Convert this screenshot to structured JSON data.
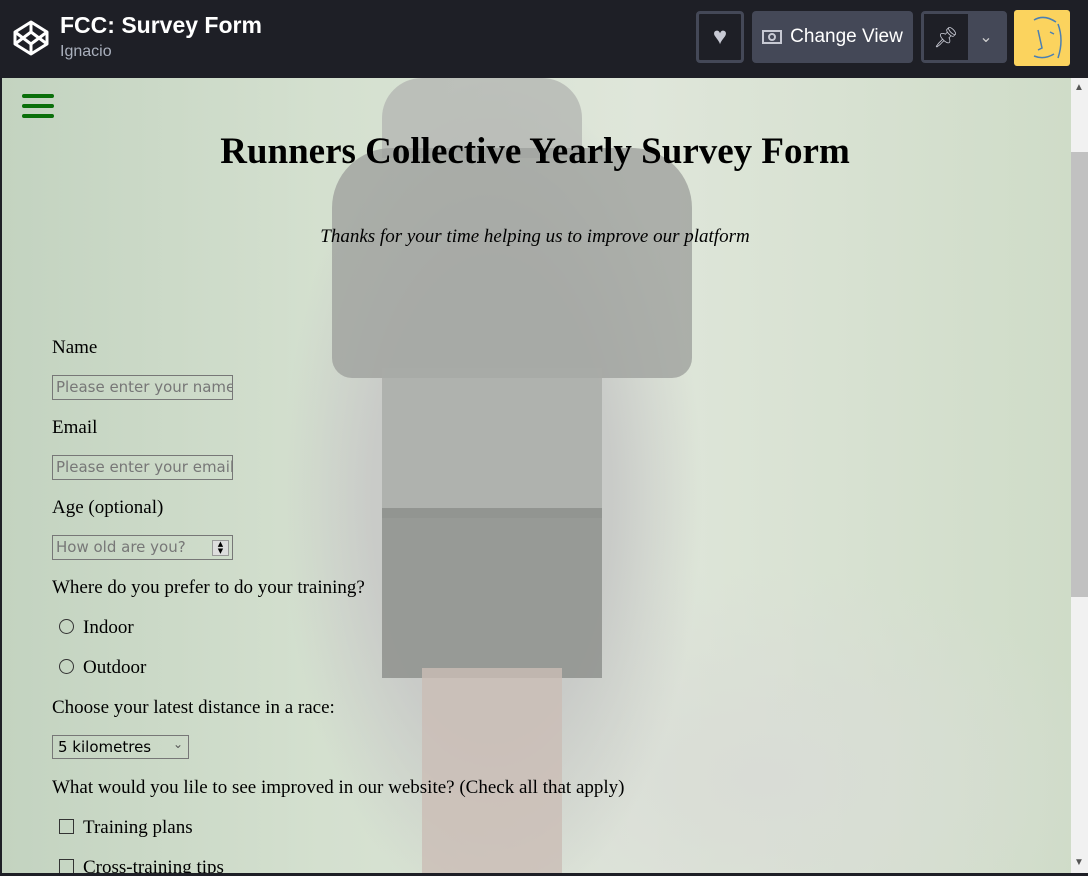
{
  "header": {
    "title": "FCC: Survey Form",
    "author": "Ignacio",
    "change_view": "Change View"
  },
  "form": {
    "title": "Runners Collective Yearly Survey Form",
    "description": "Thanks for your time helping us to improve our platform",
    "name_label": "Name",
    "name_placeholder": "Please enter your name",
    "email_label": "Email",
    "email_placeholder": "Please enter your email",
    "age_label": "Age (optional)",
    "age_placeholder": "How old are you?",
    "training_label": "Where do you prefer to do your training?",
    "training_options": [
      "Indoor",
      "Outdoor"
    ],
    "distance_label": "Choose your latest distance in a race:",
    "distance_selected": "5 kilometres",
    "improve_label": "What would you lile to see improved in our website? (Check all that apply)",
    "improve_options": [
      "Training plans",
      "Cross-training tips"
    ]
  },
  "colors": {
    "topbar": "#1e1f26",
    "accent": "#0a6f0a",
    "avatar": "#fbd35e"
  }
}
